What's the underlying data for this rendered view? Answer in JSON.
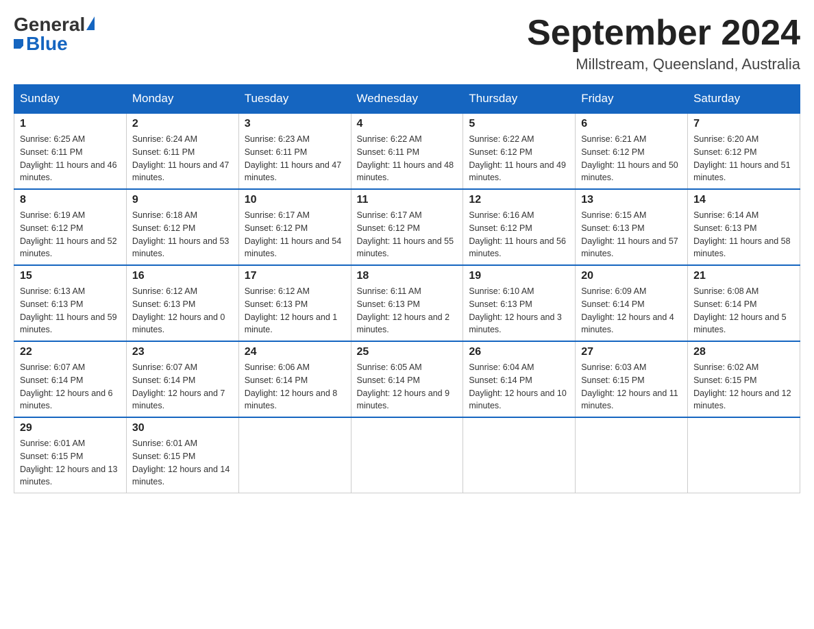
{
  "header": {
    "logo_general": "General",
    "logo_blue": "Blue",
    "month_title": "September 2024",
    "location": "Millstream, Queensland, Australia"
  },
  "weekdays": [
    "Sunday",
    "Monday",
    "Tuesday",
    "Wednesday",
    "Thursday",
    "Friday",
    "Saturday"
  ],
  "weeks": [
    [
      {
        "day": "1",
        "sunrise": "6:25 AM",
        "sunset": "6:11 PM",
        "daylight": "11 hours and 46 minutes."
      },
      {
        "day": "2",
        "sunrise": "6:24 AM",
        "sunset": "6:11 PM",
        "daylight": "11 hours and 47 minutes."
      },
      {
        "day": "3",
        "sunrise": "6:23 AM",
        "sunset": "6:11 PM",
        "daylight": "11 hours and 47 minutes."
      },
      {
        "day": "4",
        "sunrise": "6:22 AM",
        "sunset": "6:11 PM",
        "daylight": "11 hours and 48 minutes."
      },
      {
        "day": "5",
        "sunrise": "6:22 AM",
        "sunset": "6:12 PM",
        "daylight": "11 hours and 49 minutes."
      },
      {
        "day": "6",
        "sunrise": "6:21 AM",
        "sunset": "6:12 PM",
        "daylight": "11 hours and 50 minutes."
      },
      {
        "day": "7",
        "sunrise": "6:20 AM",
        "sunset": "6:12 PM",
        "daylight": "11 hours and 51 minutes."
      }
    ],
    [
      {
        "day": "8",
        "sunrise": "6:19 AM",
        "sunset": "6:12 PM",
        "daylight": "11 hours and 52 minutes."
      },
      {
        "day": "9",
        "sunrise": "6:18 AM",
        "sunset": "6:12 PM",
        "daylight": "11 hours and 53 minutes."
      },
      {
        "day": "10",
        "sunrise": "6:17 AM",
        "sunset": "6:12 PM",
        "daylight": "11 hours and 54 minutes."
      },
      {
        "day": "11",
        "sunrise": "6:17 AM",
        "sunset": "6:12 PM",
        "daylight": "11 hours and 55 minutes."
      },
      {
        "day": "12",
        "sunrise": "6:16 AM",
        "sunset": "6:12 PM",
        "daylight": "11 hours and 56 minutes."
      },
      {
        "day": "13",
        "sunrise": "6:15 AM",
        "sunset": "6:13 PM",
        "daylight": "11 hours and 57 minutes."
      },
      {
        "day": "14",
        "sunrise": "6:14 AM",
        "sunset": "6:13 PM",
        "daylight": "11 hours and 58 minutes."
      }
    ],
    [
      {
        "day": "15",
        "sunrise": "6:13 AM",
        "sunset": "6:13 PM",
        "daylight": "11 hours and 59 minutes."
      },
      {
        "day": "16",
        "sunrise": "6:12 AM",
        "sunset": "6:13 PM",
        "daylight": "12 hours and 0 minutes."
      },
      {
        "day": "17",
        "sunrise": "6:12 AM",
        "sunset": "6:13 PM",
        "daylight": "12 hours and 1 minute."
      },
      {
        "day": "18",
        "sunrise": "6:11 AM",
        "sunset": "6:13 PM",
        "daylight": "12 hours and 2 minutes."
      },
      {
        "day": "19",
        "sunrise": "6:10 AM",
        "sunset": "6:13 PM",
        "daylight": "12 hours and 3 minutes."
      },
      {
        "day": "20",
        "sunrise": "6:09 AM",
        "sunset": "6:14 PM",
        "daylight": "12 hours and 4 minutes."
      },
      {
        "day": "21",
        "sunrise": "6:08 AM",
        "sunset": "6:14 PM",
        "daylight": "12 hours and 5 minutes."
      }
    ],
    [
      {
        "day": "22",
        "sunrise": "6:07 AM",
        "sunset": "6:14 PM",
        "daylight": "12 hours and 6 minutes."
      },
      {
        "day": "23",
        "sunrise": "6:07 AM",
        "sunset": "6:14 PM",
        "daylight": "12 hours and 7 minutes."
      },
      {
        "day": "24",
        "sunrise": "6:06 AM",
        "sunset": "6:14 PM",
        "daylight": "12 hours and 8 minutes."
      },
      {
        "day": "25",
        "sunrise": "6:05 AM",
        "sunset": "6:14 PM",
        "daylight": "12 hours and 9 minutes."
      },
      {
        "day": "26",
        "sunrise": "6:04 AM",
        "sunset": "6:14 PM",
        "daylight": "12 hours and 10 minutes."
      },
      {
        "day": "27",
        "sunrise": "6:03 AM",
        "sunset": "6:15 PM",
        "daylight": "12 hours and 11 minutes."
      },
      {
        "day": "28",
        "sunrise": "6:02 AM",
        "sunset": "6:15 PM",
        "daylight": "12 hours and 12 minutes."
      }
    ],
    [
      {
        "day": "29",
        "sunrise": "6:01 AM",
        "sunset": "6:15 PM",
        "daylight": "12 hours and 13 minutes."
      },
      {
        "day": "30",
        "sunrise": "6:01 AM",
        "sunset": "6:15 PM",
        "daylight": "12 hours and 14 minutes."
      },
      null,
      null,
      null,
      null,
      null
    ]
  ]
}
